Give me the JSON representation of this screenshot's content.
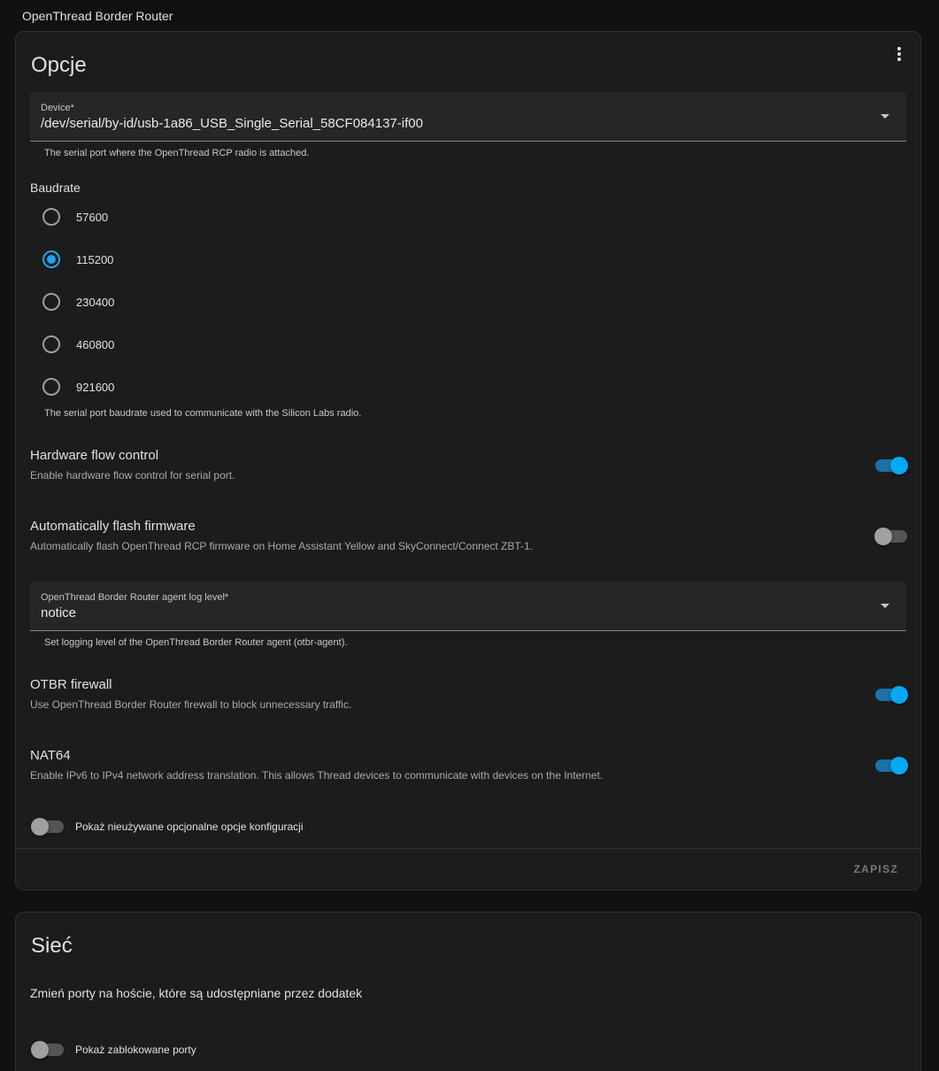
{
  "page": {
    "title": "OpenThread Border Router"
  },
  "options": {
    "title": "Opcje",
    "device": {
      "label": "Device*",
      "value": "/dev/serial/by-id/usb-1a86_USB_Single_Serial_58CF084137-if00",
      "helper": "The serial port where the OpenThread RCP radio is attached."
    },
    "baudrate": {
      "label": "Baudrate",
      "options": [
        "57600",
        "115200",
        "230400",
        "460800",
        "921600"
      ],
      "selected": "115200",
      "helper": "The serial port baudrate used to communicate with the Silicon Labs radio."
    },
    "flow_control": {
      "title": "Hardware flow control",
      "description": "Enable hardware flow control for serial port.",
      "enabled": true
    },
    "autoflash": {
      "title": "Automatically flash firmware",
      "description": "Automatically flash OpenThread RCP firmware on Home Assistant Yellow and SkyConnect/Connect ZBT-1.",
      "enabled": false
    },
    "log_level": {
      "label": "OpenThread Border Router agent log level*",
      "value": "notice",
      "helper": "Set logging level of the OpenThread Border Router agent (otbr-agent)."
    },
    "firewall": {
      "title": "OTBR firewall",
      "description": "Use OpenThread Border Router firewall to block unnecessary traffic.",
      "enabled": true
    },
    "nat64": {
      "title": "NAT64",
      "description": "Enable IPv6 to IPv4 network address translation. This allows Thread devices to communicate with devices on the Internet.",
      "enabled": true
    },
    "show_unused": {
      "label": "Pokaż nieużywane opcjonalne opcje konfiguracji",
      "enabled": false
    },
    "save_label": "ZAPISZ"
  },
  "network": {
    "title": "Sieć",
    "description": "Zmień porty na hoście, które są udostępniane przez dodatek",
    "show_blocked": {
      "label": "Pokaż zablokowane porty",
      "enabled": false
    }
  },
  "colors": {
    "accent": "#03a9f4",
    "background": "#111111",
    "card": "#1c1c1c"
  }
}
